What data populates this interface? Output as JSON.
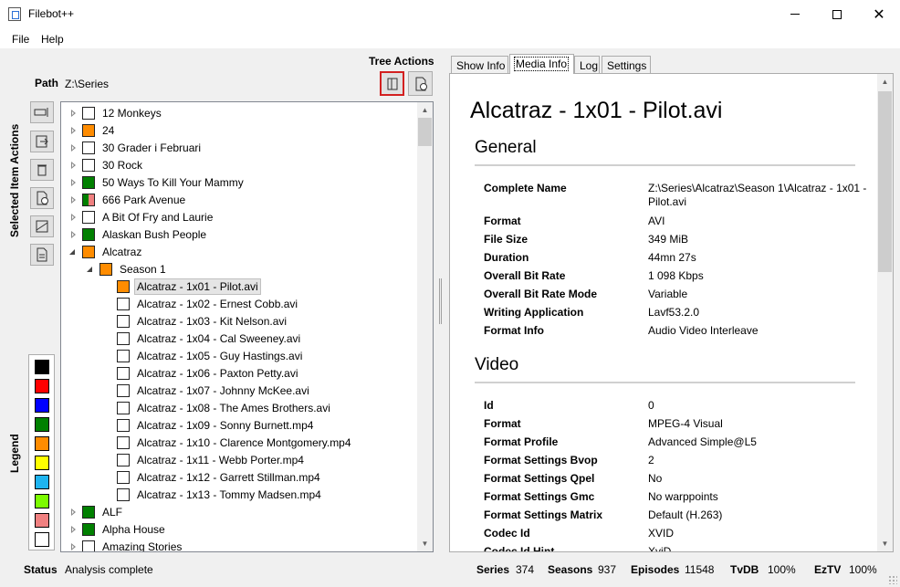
{
  "window": {
    "title": "Filebot++"
  },
  "menu": [
    {
      "label": "File"
    },
    {
      "label": "Help"
    }
  ],
  "tree_actions": {
    "title": "Tree Actions"
  },
  "path": {
    "label": "Path",
    "value": "Z:\\Series"
  },
  "selected_item_actions": {
    "label": "Selected Item Actions"
  },
  "legend": {
    "label": "Legend",
    "colors": [
      "#000000",
      "#ff0000",
      "#0000ff",
      "#008000",
      "#ff8c00",
      "#ffff00",
      "#1eb4f0",
      "#7cfc00",
      "#f08080",
      "#ffffff"
    ]
  },
  "tree": [
    {
      "level": 0,
      "arrow": "closed",
      "box": "#ffffff",
      "label": "12 Monkeys"
    },
    {
      "level": 0,
      "arrow": "closed",
      "box": "#ff8c00",
      "label": "24"
    },
    {
      "level": 0,
      "arrow": "closed",
      "box": "#ffffff",
      "label": "30 Grader i Februari"
    },
    {
      "level": 0,
      "arrow": "closed",
      "box": "#ffffff",
      "label": "30 Rock"
    },
    {
      "level": 0,
      "arrow": "closed",
      "box": "#008000",
      "label": "50 Ways To Kill Your Mammy"
    },
    {
      "level": 0,
      "arrow": "closed",
      "box": "split",
      "label": "666 Park Avenue"
    },
    {
      "level": 0,
      "arrow": "closed",
      "box": "#ffffff",
      "label": "A Bit Of Fry and Laurie"
    },
    {
      "level": 0,
      "arrow": "closed",
      "box": "#008000",
      "label": "Alaskan Bush People"
    },
    {
      "level": 0,
      "arrow": "open",
      "box": "#ff8c00",
      "label": "Alcatraz"
    },
    {
      "level": 1,
      "arrow": "open",
      "box": "#ff8c00",
      "label": "Season 1"
    },
    {
      "level": 2,
      "arrow": "none",
      "box": "#ff8c00",
      "label": "Alcatraz - 1x01 - Pilot.avi",
      "selected": true
    },
    {
      "level": 2,
      "arrow": "none",
      "box": "#ffffff",
      "label": "Alcatraz - 1x02 - Ernest Cobb.avi"
    },
    {
      "level": 2,
      "arrow": "none",
      "box": "#ffffff",
      "label": "Alcatraz - 1x03 - Kit Nelson.avi"
    },
    {
      "level": 2,
      "arrow": "none",
      "box": "#ffffff",
      "label": "Alcatraz - 1x04 - Cal Sweeney.avi"
    },
    {
      "level": 2,
      "arrow": "none",
      "box": "#ffffff",
      "label": "Alcatraz - 1x05 - Guy Hastings.avi"
    },
    {
      "level": 2,
      "arrow": "none",
      "box": "#ffffff",
      "label": "Alcatraz - 1x06 - Paxton Petty.avi"
    },
    {
      "level": 2,
      "arrow": "none",
      "box": "#ffffff",
      "label": "Alcatraz - 1x07 - Johnny McKee.avi"
    },
    {
      "level": 2,
      "arrow": "none",
      "box": "#ffffff",
      "label": "Alcatraz - 1x08 - The Ames Brothers.avi"
    },
    {
      "level": 2,
      "arrow": "none",
      "box": "#ffffff",
      "label": "Alcatraz - 1x09 - Sonny Burnett.mp4"
    },
    {
      "level": 2,
      "arrow": "none",
      "box": "#ffffff",
      "label": "Alcatraz - 1x10 - Clarence Montgomery.mp4"
    },
    {
      "level": 2,
      "arrow": "none",
      "box": "#ffffff",
      "label": "Alcatraz - 1x11 - Webb Porter.mp4"
    },
    {
      "level": 2,
      "arrow": "none",
      "box": "#ffffff",
      "label": "Alcatraz - 1x12 - Garrett Stillman.mp4"
    },
    {
      "level": 2,
      "arrow": "none",
      "box": "#ffffff",
      "label": "Alcatraz - 1x13 - Tommy Madsen.mp4"
    },
    {
      "level": 0,
      "arrow": "closed",
      "box": "#008000",
      "label": "ALF"
    },
    {
      "level": 0,
      "arrow": "closed",
      "box": "#008000",
      "label": "Alpha House"
    },
    {
      "level": 0,
      "arrow": "closed",
      "box": "#ffffff",
      "label": "Amazing Stories"
    }
  ],
  "tabs": [
    {
      "label": "Show Info",
      "active": false
    },
    {
      "label": "Media Info",
      "active": true
    },
    {
      "label": "Log",
      "active": false
    },
    {
      "label": "Settings",
      "active": false
    }
  ],
  "media": {
    "title": "Alcatraz - 1x01 - Pilot.avi",
    "sections": [
      {
        "heading": "General",
        "props": [
          {
            "k": "Complete Name",
            "v": "Z:\\Series\\Alcatraz\\Season 1\\Alcatraz - 1x01 - Pilot.avi"
          },
          {
            "k": "Format",
            "v": "AVI"
          },
          {
            "k": "File Size",
            "v": "349 MiB"
          },
          {
            "k": "Duration",
            "v": "44mn 27s"
          },
          {
            "k": "Overall Bit Rate",
            "v": "1 098 Kbps"
          },
          {
            "k": "Overall Bit Rate Mode",
            "v": "Variable"
          },
          {
            "k": "Writing Application",
            "v": "Lavf53.2.0"
          },
          {
            "k": "Format Info",
            "v": "Audio Video Interleave"
          }
        ]
      },
      {
        "heading": "Video",
        "props": [
          {
            "k": "Id",
            "v": "0"
          },
          {
            "k": "Format",
            "v": "MPEG-4 Visual"
          },
          {
            "k": "Format Profile",
            "v": "Advanced Simple@L5"
          },
          {
            "k": "Format Settings Bvop",
            "v": "2"
          },
          {
            "k": "Format Settings Qpel",
            "v": "No"
          },
          {
            "k": "Format Settings Gmc",
            "v": "No warppoints"
          },
          {
            "k": "Format Settings Matrix",
            "v": "Default (H.263)"
          },
          {
            "k": "Codec Id",
            "v": "XVID"
          },
          {
            "k": "Codec Id Hint",
            "v": "XviD"
          }
        ]
      }
    ]
  },
  "status": {
    "label": "Status",
    "value": "Analysis complete",
    "series_label": "Series",
    "series": "374",
    "seasons_label": "Seasons",
    "seasons": "937",
    "episodes_label": "Episodes",
    "episodes": "11548",
    "tvdb_label": "TvDB",
    "tvdb": "100%",
    "eztv_label": "EzTV",
    "eztv": "100%"
  }
}
